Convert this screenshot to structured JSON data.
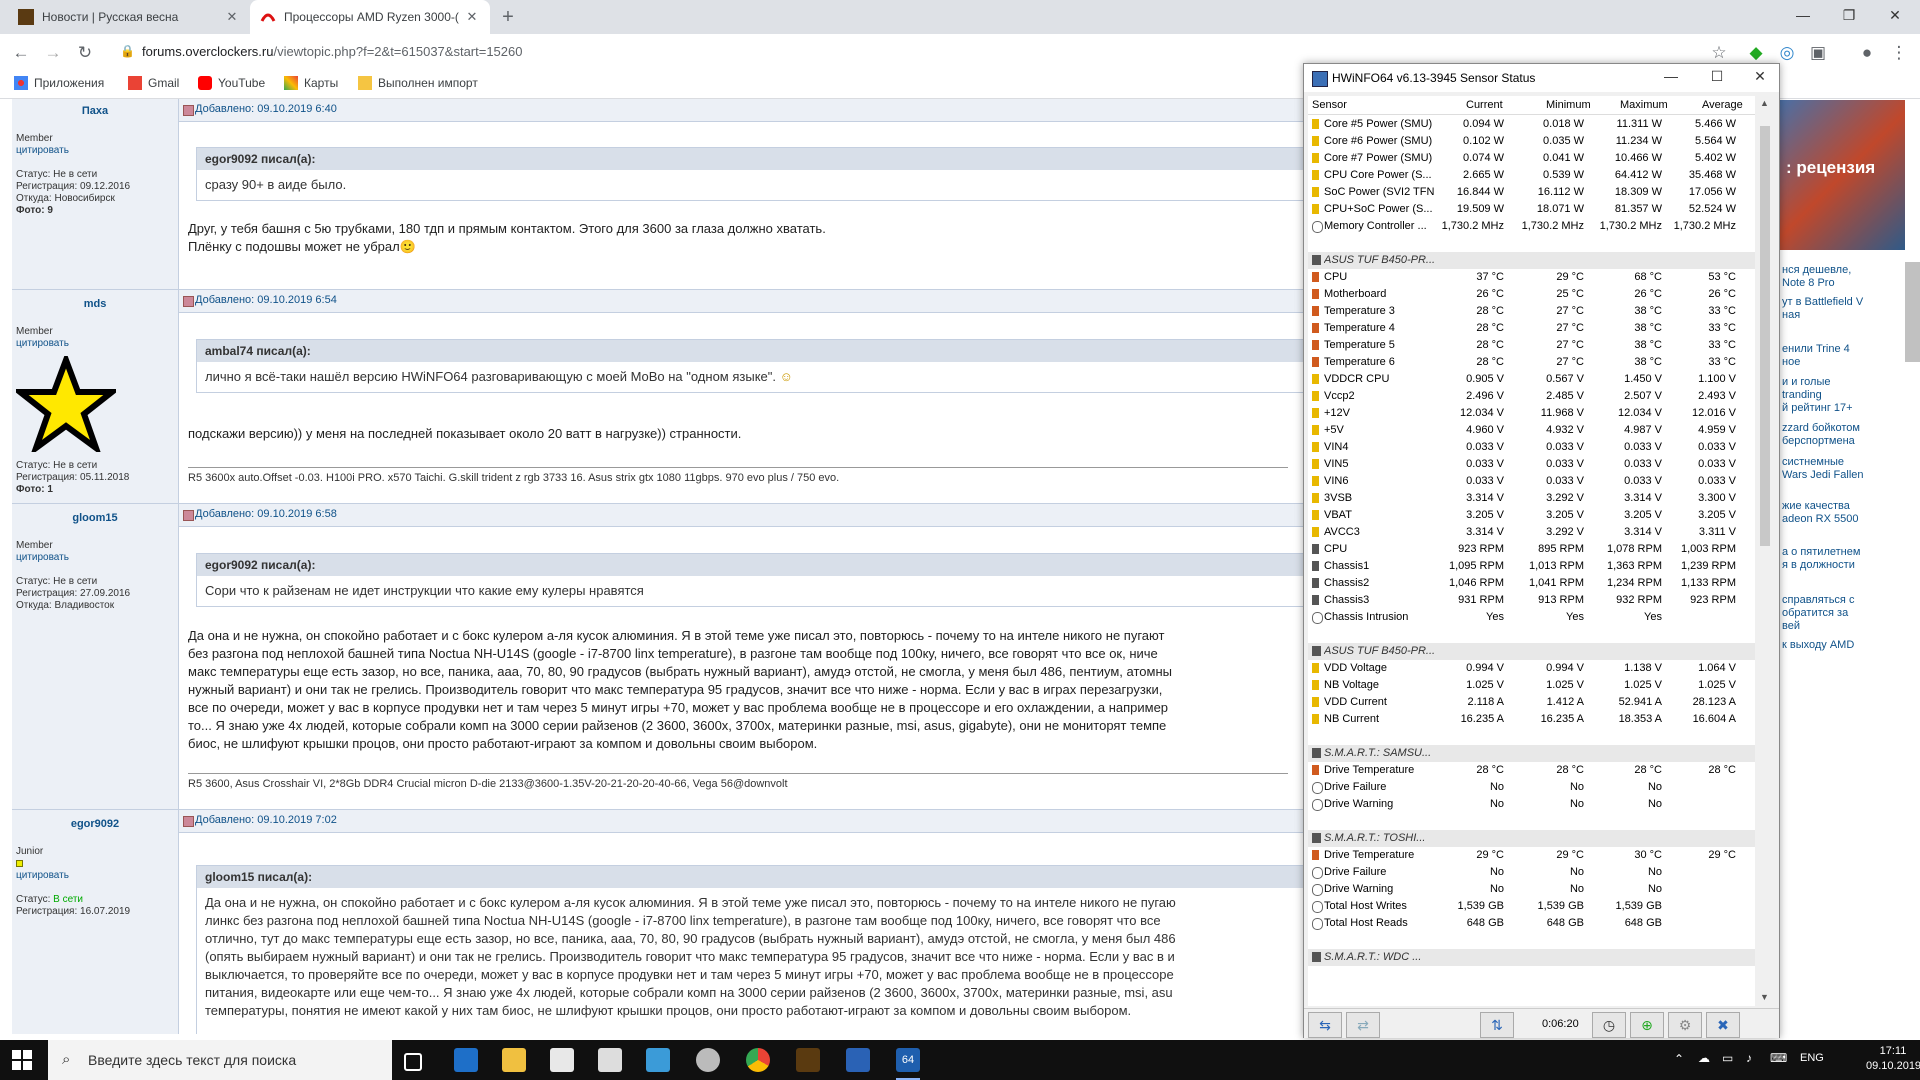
{
  "tabs": [
    {
      "title": "Новости | Русская весна",
      "active": false
    },
    {
      "title": "Процессоры AMD Ryzen 3000-(",
      "active": true
    }
  ],
  "url": {
    "host": "forums.overclockers.ru",
    "path": "/viewtopic.php?f=2&t=615037&start=15260"
  },
  "bookmarks": [
    "Приложения",
    "Gmail",
    "YouTube",
    "Карты",
    "Выполнен импорт"
  ],
  "posts": [
    {
      "user": "Паха",
      "rank": "Member",
      "cite": "цитировать",
      "status": "Статус: Не в сети",
      "reg": "Регистрация: 09.12.2016",
      "from": "Откуда: Новосибирск",
      "photo": "Фото: 9",
      "date_label": "Добавлено:",
      "date": "09.10.2019 6:40",
      "quote_author": "egor9092 писал(а):",
      "quote_text": "сразу 90+ в аиде было.",
      "text": "Друг, у тебя башня с 5ю трубками, 180 тдп и прямым контактом. Этого для 3600 за глаза должно хватать.",
      "text2": "Плёнку с подошвы может не убрал🙂"
    },
    {
      "user": "mds",
      "rank": "Member",
      "cite": "цитировать",
      "status": "Статус: Не в сети",
      "reg": "Регистрация: 05.11.2018",
      "photo": "Фото: 1",
      "date_label": "Добавлено:",
      "date": "09.10.2019 6:54",
      "quote_author": "ambal74 писал(а):",
      "quote_text": "лично я всё-таки нашёл версию HWiNFO64 разговаривающую с моей MoBo на \"одном языке\".",
      "text": "подскажи версию)) у меня на последней показывает около 20 ватт в нагрузке)) странности.",
      "sig": "R5 3600x auto.Offset -0.03. H100i PRO. x570 Taichi. G.skill trident z rgb 3733 16. Asus strix gtx 1080 11gbps. 970 evo plus / 750 evo."
    },
    {
      "user": "gloom15",
      "rank": "Member",
      "cite": "цитировать",
      "status": "Статус: Не в сети",
      "reg": "Регистрация: 27.09.2016",
      "from": "Откуда: Владивосток",
      "date_label": "Добавлено:",
      "date": "09.10.2019 6:58",
      "quote_author": "egor9092 писал(а):",
      "quote_text": "Сори что к райзенам не идет инструкции что какие ему кулеры нравятся",
      "text_lines": [
        "Да она и не нужна, он спокойно работает и с бокс кулером а-ля кусок алюминия. Я в этой теме уже писал это, повторюсь - почему то на интеле никого не пугают",
        "без разгона под неплохой башней типа Noctua NH-U14S (google - i7-8700 linx temperature), в разгоне там вообще под 100ку, ничего, все говорят что все ок, ниче",
        "макс температуры еще есть зазор, но все, паника, ааа, 70, 80, 90 градусов (выбрать нужный вариант), амудэ отстой, не смогла, у меня был 486, пентиум, атомны",
        "нужный вариант) и они так не грелись. Производитель говорит что макс температура 95 градусов, значит все что ниже - норма. Если у вас в играх перезагрузки,",
        "все по очереди, может у вас в корпусе продувки нет и там через 5 минут игры +70, может у вас проблема вообще не в процессоре и его охлаждении, а например",
        "то... Я знаю уже 4х людей, которые собрали комп на 3000 серии райзенов (2 3600, 3600x, 3700x, материнки разные, msi, asus, gigabyte), они не мониторят темпе",
        "биос, не шлифуют крышки процов, они просто работают-играют за компом и довольны своим выбором."
      ],
      "sig": "R5 3600, Asus Crosshair VI, 2*8Gb DDR4 Crucial micron D-die 2133@3600-1.35V-20-21-20-20-40-66, Vega 56@downvolt"
    },
    {
      "user": "egor9092",
      "rank": "Junior",
      "cite": "цитировать",
      "status_prefix": "Статус:",
      "status_online": "В сети",
      "reg": "Регистрация: 16.07.2019",
      "date_label": "Добавлено:",
      "date": "09.10.2019 7:02",
      "quote_author": "gloom15 писал(а):",
      "quote_lines": [
        "Да она и не нужна, он спокойно работает и с бокс кулером а-ля кусок алюминия. Я в этой теме уже писал это, повторюсь - почему то на интеле никого не пугаю",
        "линкс без разгона под неплохой башней типа Noctua NH-U14S (google - i7-8700 linx temperature), в разгоне там вообще под 100ку, ничего, все говорят что все",
        "отлично, тут до макс температуры еще есть зазор, но все, паника, ааа, 70, 80, 90 градусов (выбрать нужный вариант), амудэ отстой, не смогла, у меня был 486",
        "(опять выбираем нужный вариант) и они так не грелись. Производитель говорит что макс температура 95 градусов, значит все что ниже - норма. Если у вас в и",
        "выключается, то проверяйте все по очереди, может у вас в корпусе продувки нет и там через 5 минут игры +70, может у вас проблема вообще не в процессоре",
        "питания, видеокарте или еще чем-то... Я знаю уже 4х людей, которые собрали комп на 3000 серии райзенов (2 3600, 3600x, 3700x, материнки разные, msi, asu",
        "температуры, понятия не имеют какой у них там биос, не шлифуют крышки процов, они просто работают-играют за компом и довольны своим выбором."
      ]
    }
  ],
  "right": {
    "hero": ": рецензия",
    "lines": [
      "нся дешевле,",
      "Note 8 Pro",
      "ут в Battlefield V",
      "ная",
      "енили Trine 4",
      "ное",
      "и и голые",
      "tranding",
      "й рейтинг 17+",
      "zzard бойкотом",
      "берспортмена",
      "систнемные",
      "Wars Jedi Fallen",
      "жие качества",
      "adeon RX 5500",
      "а о пятилетнем",
      "я в должности",
      "справляться с",
      "обратится за",
      "вей",
      "к выходу AMD"
    ]
  },
  "hwinfo": {
    "title": "HWiNFO64 v6.13-3945 Sensor Status",
    "headers": [
      "Sensor",
      "Current",
      "Minimum",
      "Maximum",
      "Average"
    ],
    "rows": [
      {
        "n": "Core #5 Power (SMU)",
        "v": [
          "0.094 W",
          "0.018 W",
          "11.311 W",
          "5.466 W"
        ],
        "t": "power"
      },
      {
        "n": "Core #6 Power (SMU)",
        "v": [
          "0.102 W",
          "0.035 W",
          "11.234 W",
          "5.564 W"
        ],
        "t": "power"
      },
      {
        "n": "Core #7 Power (SMU)",
        "v": [
          "0.074 W",
          "0.041 W",
          "10.466 W",
          "5.402 W"
        ],
        "t": "power"
      },
      {
        "n": "CPU Core Power (S...",
        "v": [
          "2.665 W",
          "0.539 W",
          "64.412 W",
          "35.468 W"
        ],
        "t": "power"
      },
      {
        "n": "SoC Power (SVI2 TFN)",
        "v": [
          "16.844 W",
          "16.112 W",
          "18.309 W",
          "17.056 W"
        ],
        "t": "power"
      },
      {
        "n": "CPU+SoC Power (S...",
        "v": [
          "19.509 W",
          "18.071 W",
          "81.357 W",
          "52.524 W"
        ],
        "t": "power"
      },
      {
        "n": "Memory Controller ...",
        "v": [
          "1,730.2 MHz",
          "1,730.2 MHz",
          "1,730.2 MHz",
          "1,730.2 MHz"
        ],
        "t": "clock"
      },
      {
        "n": "",
        "v": [
          "",
          "",
          "",
          ""
        ],
        "t": "blank"
      },
      {
        "n": "ASUS TUF B450-PR...",
        "v": [
          "",
          "",
          "",
          ""
        ],
        "t": "group"
      },
      {
        "n": "CPU",
        "v": [
          "37 °C",
          "29 °C",
          "68 °C",
          "53 °C"
        ],
        "t": "temp"
      },
      {
        "n": "Motherboard",
        "v": [
          "26 °C",
          "25 °C",
          "26 °C",
          "26 °C"
        ],
        "t": "temp"
      },
      {
        "n": "Temperature 3",
        "v": [
          "28 °C",
          "27 °C",
          "38 °C",
          "33 °C"
        ],
        "t": "temp"
      },
      {
        "n": "Temperature 4",
        "v": [
          "28 °C",
          "27 °C",
          "38 °C",
          "33 °C"
        ],
        "t": "temp"
      },
      {
        "n": "Temperature 5",
        "v": [
          "28 °C",
          "27 °C",
          "38 °C",
          "33 °C"
        ],
        "t": "temp"
      },
      {
        "n": "Temperature 6",
        "v": [
          "28 °C",
          "27 °C",
          "38 °C",
          "33 °C"
        ],
        "t": "temp"
      },
      {
        "n": "VDDCR CPU",
        "v": [
          "0.905 V",
          "0.567 V",
          "1.450 V",
          "1.100 V"
        ],
        "t": "volt"
      },
      {
        "n": "Vccp2",
        "v": [
          "2.496 V",
          "2.485 V",
          "2.507 V",
          "2.493 V"
        ],
        "t": "volt"
      },
      {
        "n": "+12V",
        "v": [
          "12.034 V",
          "11.968 V",
          "12.034 V",
          "12.016 V"
        ],
        "t": "volt"
      },
      {
        "n": "+5V",
        "v": [
          "4.960 V",
          "4.932 V",
          "4.987 V",
          "4.959 V"
        ],
        "t": "volt"
      },
      {
        "n": "VIN4",
        "v": [
          "0.033 V",
          "0.033 V",
          "0.033 V",
          "0.033 V"
        ],
        "t": "volt"
      },
      {
        "n": "VIN5",
        "v": [
          "0.033 V",
          "0.033 V",
          "0.033 V",
          "0.033 V"
        ],
        "t": "volt"
      },
      {
        "n": "VIN6",
        "v": [
          "0.033 V",
          "0.033 V",
          "0.033 V",
          "0.033 V"
        ],
        "t": "volt"
      },
      {
        "n": "3VSB",
        "v": [
          "3.314 V",
          "3.292 V",
          "3.314 V",
          "3.300 V"
        ],
        "t": "volt"
      },
      {
        "n": "VBAT",
        "v": [
          "3.205 V",
          "3.205 V",
          "3.205 V",
          "3.205 V"
        ],
        "t": "volt"
      },
      {
        "n": "AVCC3",
        "v": [
          "3.314 V",
          "3.292 V",
          "3.314 V",
          "3.311 V"
        ],
        "t": "volt"
      },
      {
        "n": "CPU",
        "v": [
          "923 RPM",
          "895 RPM",
          "1,078 RPM",
          "1,003 RPM"
        ],
        "t": "fan"
      },
      {
        "n": "Chassis1",
        "v": [
          "1,095 RPM",
          "1,013 RPM",
          "1,363 RPM",
          "1,239 RPM"
        ],
        "t": "fan"
      },
      {
        "n": "Chassis2",
        "v": [
          "1,046 RPM",
          "1,041 RPM",
          "1,234 RPM",
          "1,133 RPM"
        ],
        "t": "fan"
      },
      {
        "n": "Chassis3",
        "v": [
          "931 RPM",
          "913 RPM",
          "932 RPM",
          "923 RPM"
        ],
        "t": "fan"
      },
      {
        "n": "Chassis Intrusion",
        "v": [
          "Yes",
          "Yes",
          "Yes",
          ""
        ],
        "t": "misc"
      },
      {
        "n": "",
        "v": [
          "",
          "",
          "",
          ""
        ],
        "t": "blank"
      },
      {
        "n": "ASUS TUF B450-PR...",
        "v": [
          "",
          "",
          "",
          ""
        ],
        "t": "group"
      },
      {
        "n": "VDD Voltage",
        "v": [
          "0.994 V",
          "0.994 V",
          "1.138 V",
          "1.064 V"
        ],
        "t": "volt"
      },
      {
        "n": "NB Voltage",
        "v": [
          "1.025 V",
          "1.025 V",
          "1.025 V",
          "1.025 V"
        ],
        "t": "volt"
      },
      {
        "n": "VDD Current",
        "v": [
          "2.118 A",
          "1.412 A",
          "52.941 A",
          "28.123 A"
        ],
        "t": "volt"
      },
      {
        "n": "NB Current",
        "v": [
          "16.235 A",
          "16.235 A",
          "18.353 A",
          "16.604 A"
        ],
        "t": "volt"
      },
      {
        "n": "",
        "v": [
          "",
          "",
          "",
          ""
        ],
        "t": "blank"
      },
      {
        "n": "S.M.A.R.T.: SAMSU...",
        "v": [
          "",
          "",
          "",
          ""
        ],
        "t": "group"
      },
      {
        "n": "Drive Temperature",
        "v": [
          "28 °C",
          "28 °C",
          "28 °C",
          "28 °C"
        ],
        "t": "temp"
      },
      {
        "n": "Drive Failure",
        "v": [
          "No",
          "No",
          "No",
          ""
        ],
        "t": "misc"
      },
      {
        "n": "Drive Warning",
        "v": [
          "No",
          "No",
          "No",
          ""
        ],
        "t": "misc"
      },
      {
        "n": "",
        "v": [
          "",
          "",
          "",
          ""
        ],
        "t": "blank"
      },
      {
        "n": "S.M.A.R.T.: TOSHI...",
        "v": [
          "",
          "",
          "",
          ""
        ],
        "t": "group"
      },
      {
        "n": "Drive Temperature",
        "v": [
          "29 °C",
          "29 °C",
          "30 °C",
          "29 °C"
        ],
        "t": "temp"
      },
      {
        "n": "Drive Failure",
        "v": [
          "No",
          "No",
          "No",
          ""
        ],
        "t": "misc"
      },
      {
        "n": "Drive Warning",
        "v": [
          "No",
          "No",
          "No",
          ""
        ],
        "t": "misc"
      },
      {
        "n": "Total Host Writes",
        "v": [
          "1,539 GB",
          "1,539 GB",
          "1,539 GB",
          ""
        ],
        "t": "misc"
      },
      {
        "n": "Total Host Reads",
        "v": [
          "648 GB",
          "648 GB",
          "648 GB",
          ""
        ],
        "t": "misc"
      },
      {
        "n": "",
        "v": [
          "",
          "",
          "",
          ""
        ],
        "t": "blank"
      },
      {
        "n": "S.M.A.R.T.: WDC ...",
        "v": [
          "",
          "",
          "",
          ""
        ],
        "t": "group"
      }
    ],
    "elapsed": "0:06:20"
  },
  "taskbar": {
    "search_placeholder": "Введите здесь текст для поиска",
    "lang": "ENG",
    "time": "17:11",
    "date": "09.10.2019"
  },
  "colors": {
    "forum_link": "#105289",
    "hw_power": "#e8b800"
  }
}
